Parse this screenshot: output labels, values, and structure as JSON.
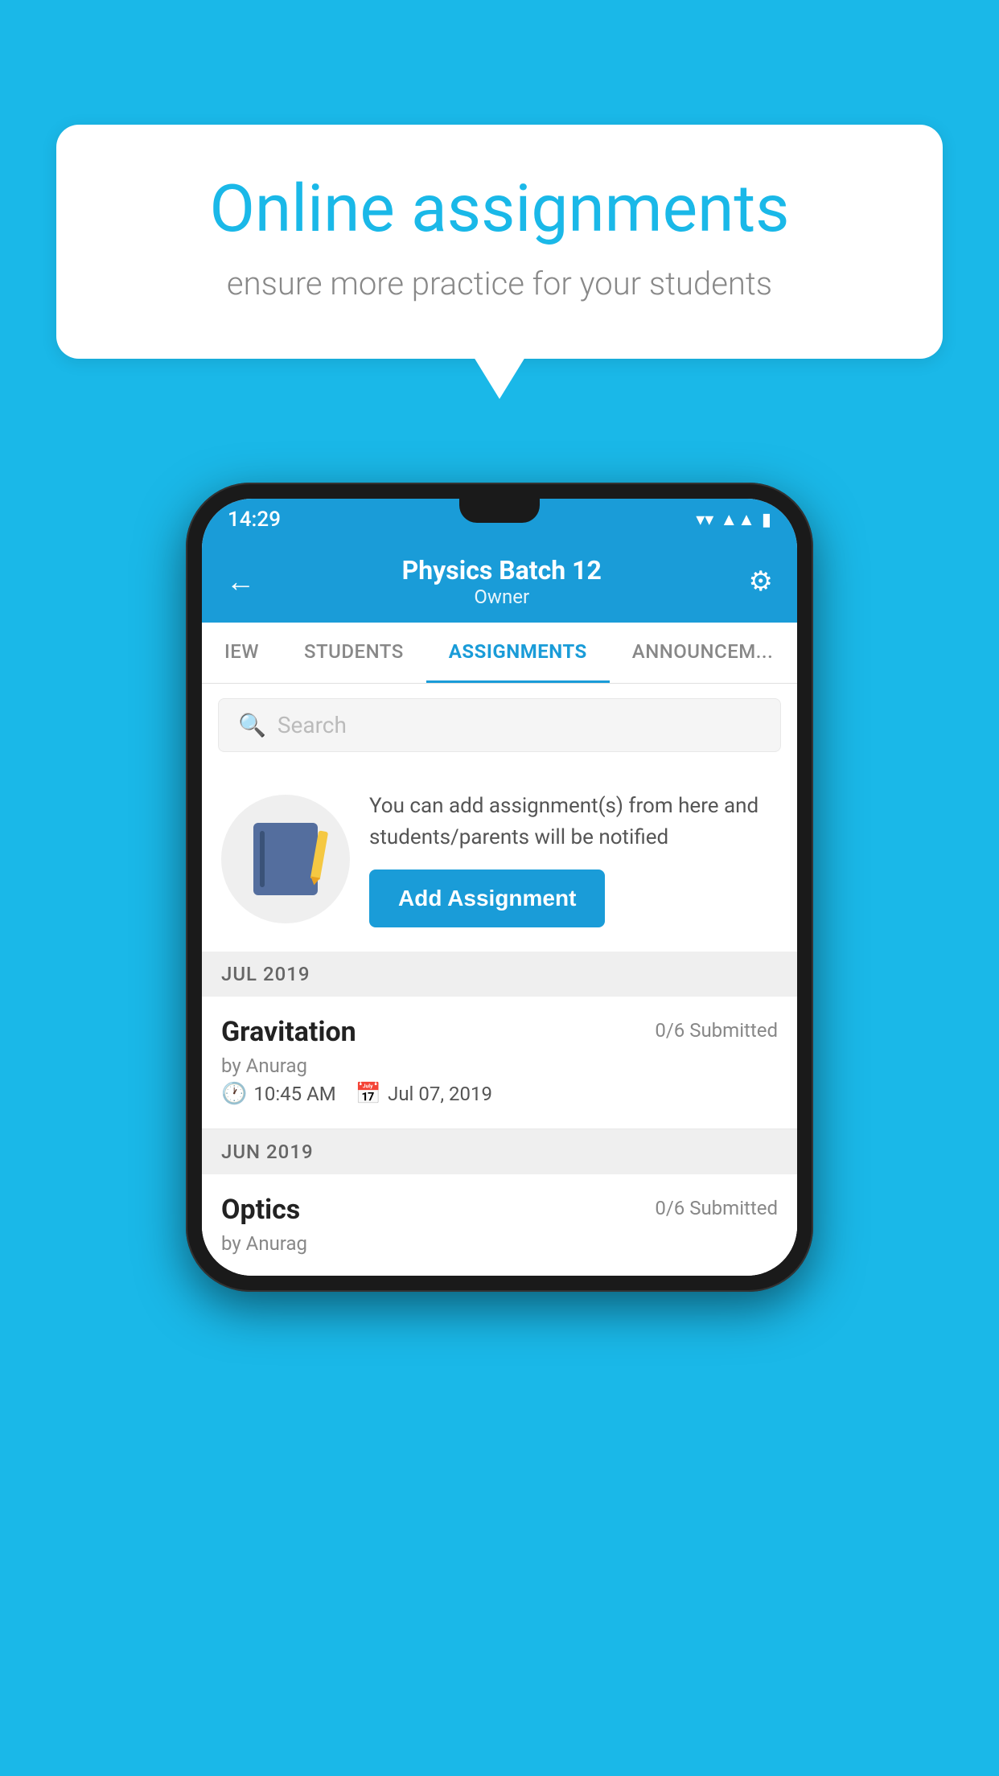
{
  "background_color": "#1ab8e8",
  "speech_bubble": {
    "title": "Online assignments",
    "subtitle": "ensure more practice for your students"
  },
  "phone": {
    "status_bar": {
      "time": "14:29",
      "wifi_icon": "wifi",
      "signal_icon": "signal",
      "battery_icon": "battery"
    },
    "header": {
      "back_label": "←",
      "title": "Physics Batch 12",
      "subtitle": "Owner",
      "settings_label": "⚙"
    },
    "tabs": [
      {
        "label": "IEW",
        "active": false
      },
      {
        "label": "STUDENTS",
        "active": false
      },
      {
        "label": "ASSIGNMENTS",
        "active": true
      },
      {
        "label": "ANNOUNCEM...",
        "active": false
      }
    ],
    "search": {
      "placeholder": "Search"
    },
    "promo": {
      "description": "You can add assignment(s) from here and students/parents will be notified",
      "button_label": "Add Assignment"
    },
    "sections": [
      {
        "month_label": "JUL 2019",
        "assignments": [
          {
            "title": "Gravitation",
            "submitted": "0/6 Submitted",
            "by": "by Anurag",
            "time": "10:45 AM",
            "date": "Jul 07, 2019"
          }
        ]
      },
      {
        "month_label": "JUN 2019",
        "assignments": [
          {
            "title": "Optics",
            "submitted": "0/6 Submitted",
            "by": "by Anurag",
            "time": "",
            "date": ""
          }
        ]
      }
    ]
  }
}
